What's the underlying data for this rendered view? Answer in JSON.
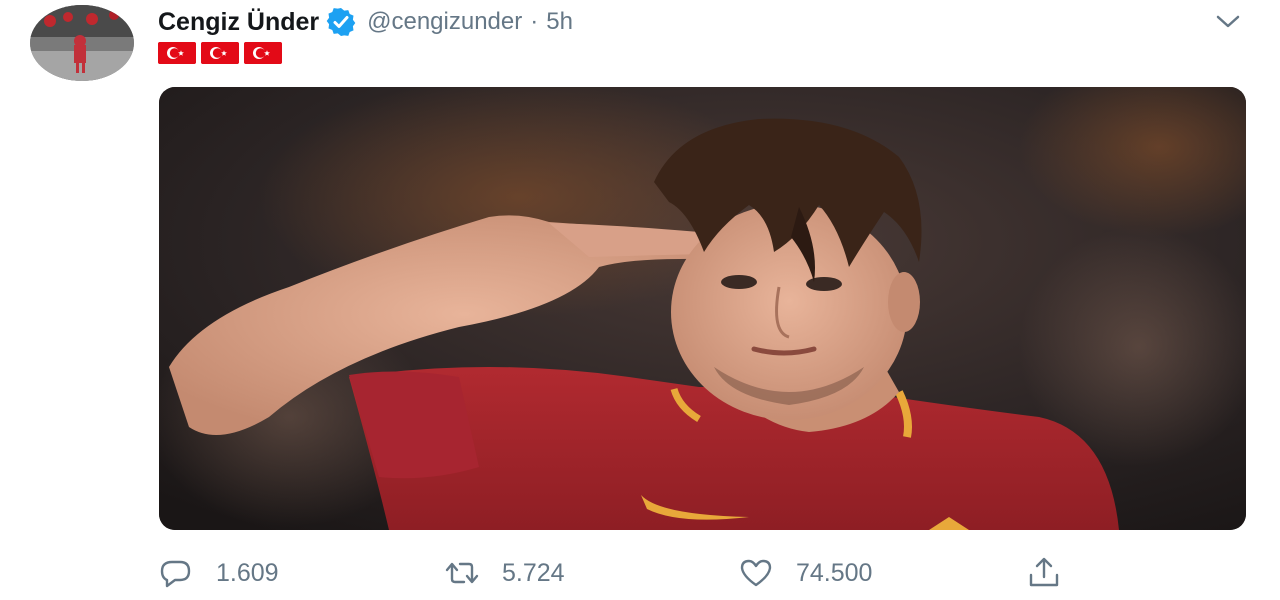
{
  "tweet": {
    "author": {
      "display_name": "Cengiz Ünder",
      "verified": true,
      "handle": "@cengizunder",
      "avatar_icon": "player-avatar"
    },
    "separator": "·",
    "time": "5h",
    "flags": [
      "turkish-flag-icon",
      "turkish-flag-icon",
      "turkish-flag-icon"
    ],
    "media": {
      "kind": "photo",
      "description_icon": "football-player-photo"
    },
    "actions": {
      "reply_count": "1.609",
      "retweet_count": "5.724",
      "like_count": "74.500"
    },
    "colors": {
      "name": "#14171a",
      "secondary": "#657786",
      "verified_blue": "#1da1f2",
      "flag_red": "#e30a17",
      "jersey": "#a3222a",
      "jersey_trim": "#e8a83a"
    }
  }
}
